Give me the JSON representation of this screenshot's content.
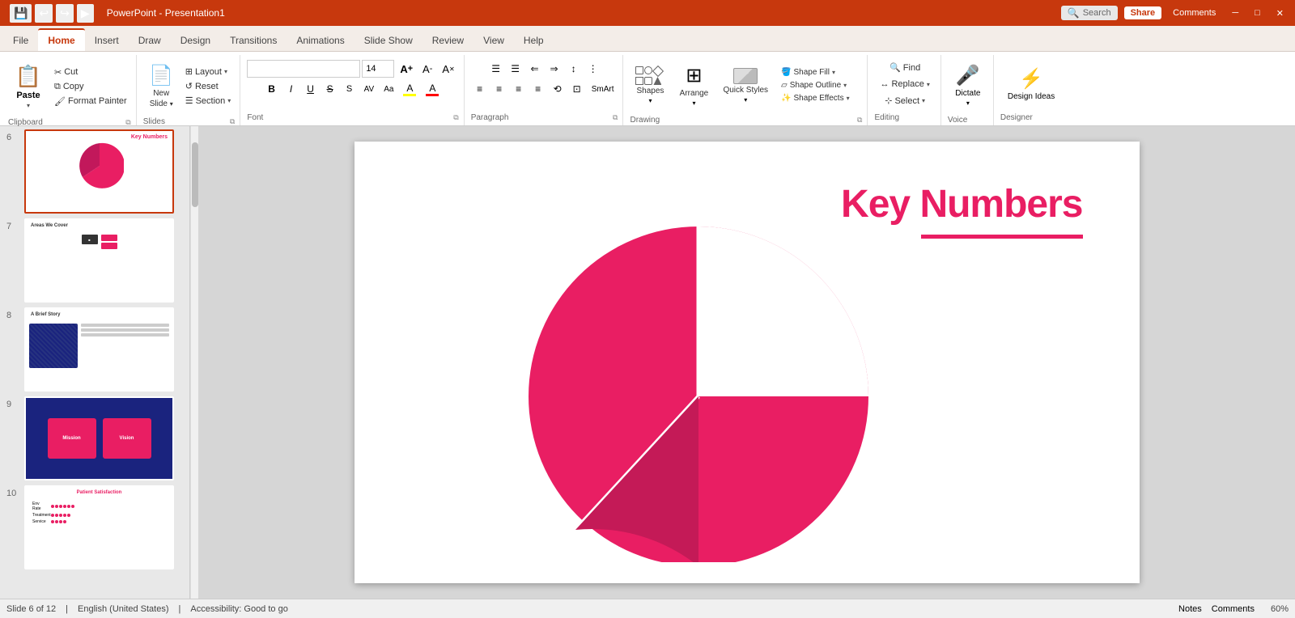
{
  "titlebar": {
    "doc_name": "PowerPoint - Presentation1",
    "share_label": "Share",
    "comments_label": "Comments",
    "window_controls": [
      "─",
      "□",
      "✕"
    ]
  },
  "tabs": [
    {
      "id": "file",
      "label": "File"
    },
    {
      "id": "home",
      "label": "Home",
      "active": true
    },
    {
      "id": "insert",
      "label": "Insert"
    },
    {
      "id": "draw",
      "label": "Draw"
    },
    {
      "id": "design",
      "label": "Design"
    },
    {
      "id": "transitions",
      "label": "Transitions"
    },
    {
      "id": "animations",
      "label": "Animations"
    },
    {
      "id": "slideshow",
      "label": "Slide Show"
    },
    {
      "id": "review",
      "label": "Review"
    },
    {
      "id": "view",
      "label": "View"
    },
    {
      "id": "help",
      "label": "Help"
    }
  ],
  "ribbon": {
    "clipboard": {
      "label": "Clipboard",
      "paste_label": "Paste",
      "cut_label": "Cut",
      "copy_label": "Copy",
      "format_painter_label": "Format Painter"
    },
    "slides": {
      "label": "Slides",
      "new_slide_label": "New Slide",
      "layout_label": "Layout",
      "reset_label": "Reset",
      "section_label": "Section"
    },
    "font": {
      "label": "Font",
      "font_name": "",
      "font_size": "14",
      "increase_font": "A↑",
      "decrease_font": "A↓",
      "clear_format": "A✕",
      "bold": "B",
      "italic": "I",
      "underline": "U",
      "strikethrough": "S",
      "shadow": "S",
      "char_spacing": "AV",
      "font_case": "Aa",
      "highlight_color": "A",
      "font_color": "A"
    },
    "paragraph": {
      "label": "Paragraph",
      "bullet_list": "≡",
      "numbered_list": "≡",
      "decrease_indent": "←",
      "increase_indent": "→",
      "cols": "☰",
      "align_left": "≡",
      "align_center": "≡",
      "align_right": "≡",
      "justify": "≡",
      "text_dir": "↕",
      "align_text": "⊡",
      "convert_to_smartart": "🔷"
    },
    "drawing": {
      "label": "Drawing",
      "quick_styles_label": "Quick Styles",
      "shape_fill_label": "Shape Fill",
      "shape_outline_label": "Shape Outline",
      "shape_effects_label": "Shape Effects",
      "shapes_label": "Shapes",
      "arrange_label": "Arrange"
    },
    "editing": {
      "label": "Editing",
      "find_label": "Find",
      "replace_label": "Replace",
      "select_label": "Select"
    },
    "voice": {
      "label": "Voice",
      "dictate_label": "Dictate"
    },
    "designer": {
      "label": "Designer",
      "design_ideas_label": "Design Ideas"
    },
    "search": {
      "placeholder": "Search"
    }
  },
  "slides": [
    {
      "number": 6,
      "active": true,
      "title": "Key Numbers",
      "type": "key_numbers"
    },
    {
      "number": 7,
      "active": false,
      "title": "Areas We Cover",
      "type": "areas"
    },
    {
      "number": 8,
      "active": false,
      "title": "A Brief Story",
      "type": "story"
    },
    {
      "number": 9,
      "active": false,
      "title": "",
      "type": "mission"
    },
    {
      "number": 10,
      "active": false,
      "title": "Patient Satisfaction",
      "type": "satisfaction"
    }
  ],
  "current_slide": {
    "title": "Key Numbers",
    "type": "key_numbers"
  },
  "status_bar": {
    "slide_info": "Slide 6 of 12",
    "language": "English (United States)",
    "accessibility": "Accessibility: Good to go",
    "notes": "Notes",
    "comments": "Comments",
    "zoom": "60%"
  },
  "colors": {
    "accent": "#e91e63",
    "tab_active": "#c7380d",
    "ribbon_bg": "#ffffff",
    "tab_bar_bg": "#f3ede8"
  }
}
